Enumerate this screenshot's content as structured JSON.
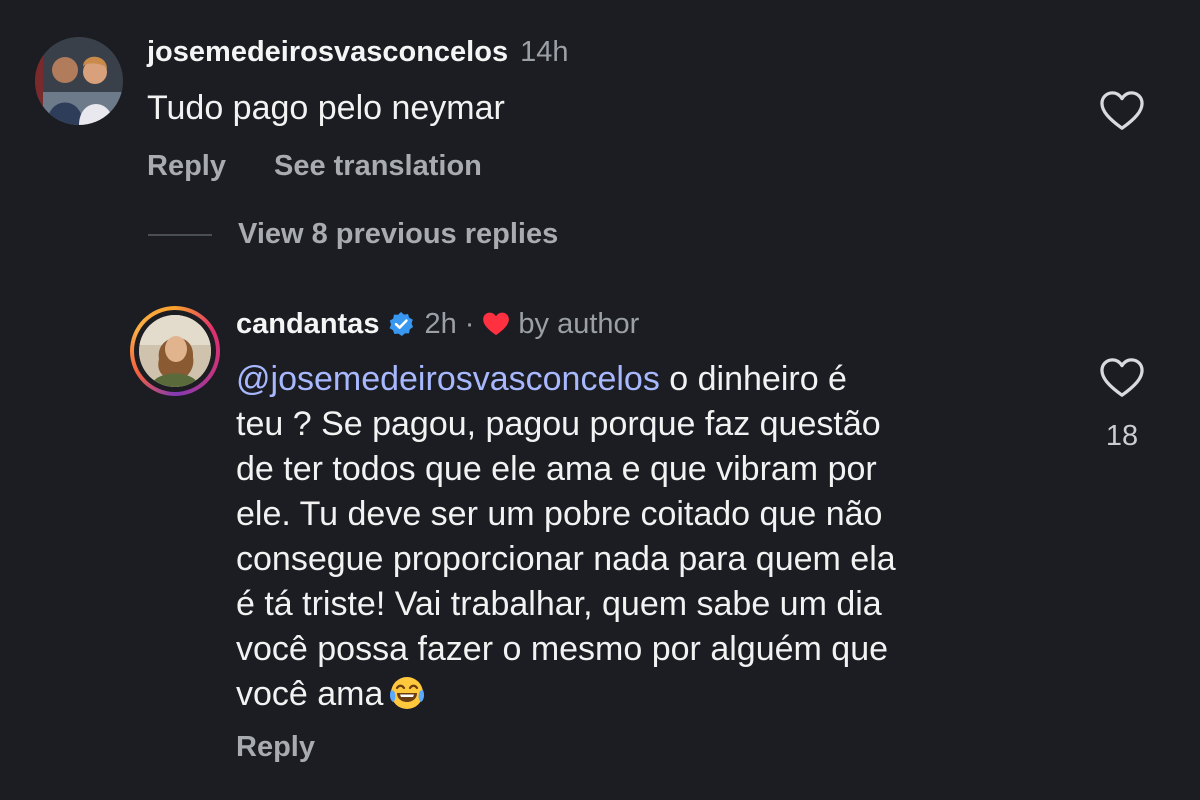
{
  "comment": {
    "username": "josemedeirosvasconcelos",
    "time": "14h",
    "text": "Tudo pago pelo neymar",
    "reply_label": "Reply",
    "translate_label": "See translation",
    "avatar_icon": "profile-photo-couple"
  },
  "view_replies": {
    "label": "View 8 previous replies"
  },
  "reply": {
    "username": "candantas",
    "verified": true,
    "time": "2h",
    "separator": "·",
    "liked_by_author_label": "by author",
    "mention": "@josemedeirosvasconcelos",
    "lines": [
      " o dinheiro é",
      "teu ? Se pagou, pagou porque faz questão",
      "de ter todos que ele ama e que vibram por",
      "ele. Tu deve ser um pobre coitado que não",
      "consegue proporcionar nada para quem ela",
      "é tá triste! Vai trabalhar, quem sabe um dia",
      "você possa fazer o mesmo por alguém que",
      "você ama"
    ],
    "emoji": "face-with-tears-of-joy",
    "reply_label": "Reply",
    "like_count": "18",
    "avatar_icon": "profile-photo-woman"
  },
  "colors": {
    "background": "#1b1d22",
    "mention": "#a8b8ff",
    "verified": "#3897f0",
    "author_heart": "#ff3040",
    "secondary_text": "#9aa0a6"
  }
}
